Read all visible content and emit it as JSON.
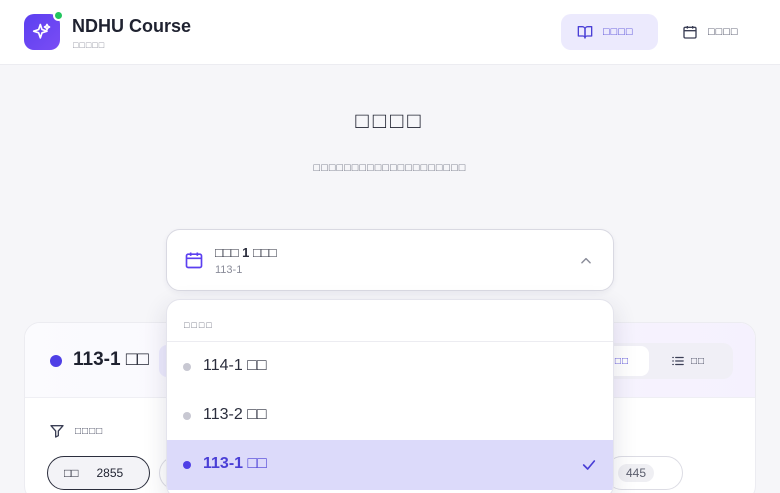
{
  "header": {
    "app_title": "NDHU Course",
    "app_subtitle": "□□□□□",
    "nav": [
      {
        "label": "□□□□",
        "icon": "book-open-icon",
        "active": true
      },
      {
        "label": "□□□□",
        "icon": "calendar-icon",
        "active": false
      }
    ]
  },
  "hero": {
    "title": "□□□□",
    "description": "□□□□□□□□□□□□□□□□□□□□"
  },
  "semester_select": {
    "label": "□□□ 1 □□□",
    "value": "113-1",
    "open": true
  },
  "dropdown": {
    "header": "□□□□",
    "options": [
      {
        "label": "114-1 □□",
        "selected": false
      },
      {
        "label": "113-2 □□",
        "selected": false
      },
      {
        "label": "113-1 □□",
        "selected": true
      }
    ]
  },
  "course_card": {
    "semester_title": "113-1 □□",
    "view_toggle": [
      "□□",
      "□□"
    ],
    "filter_label": "□□□□",
    "counts": [
      {
        "label": "□□",
        "value": "2855"
      },
      {
        "label": "",
        "value": "445"
      }
    ]
  },
  "colors": {
    "accent": "#4f3fe6",
    "online_dot": "#22c55e",
    "selected_bg": "#dcdafa"
  }
}
